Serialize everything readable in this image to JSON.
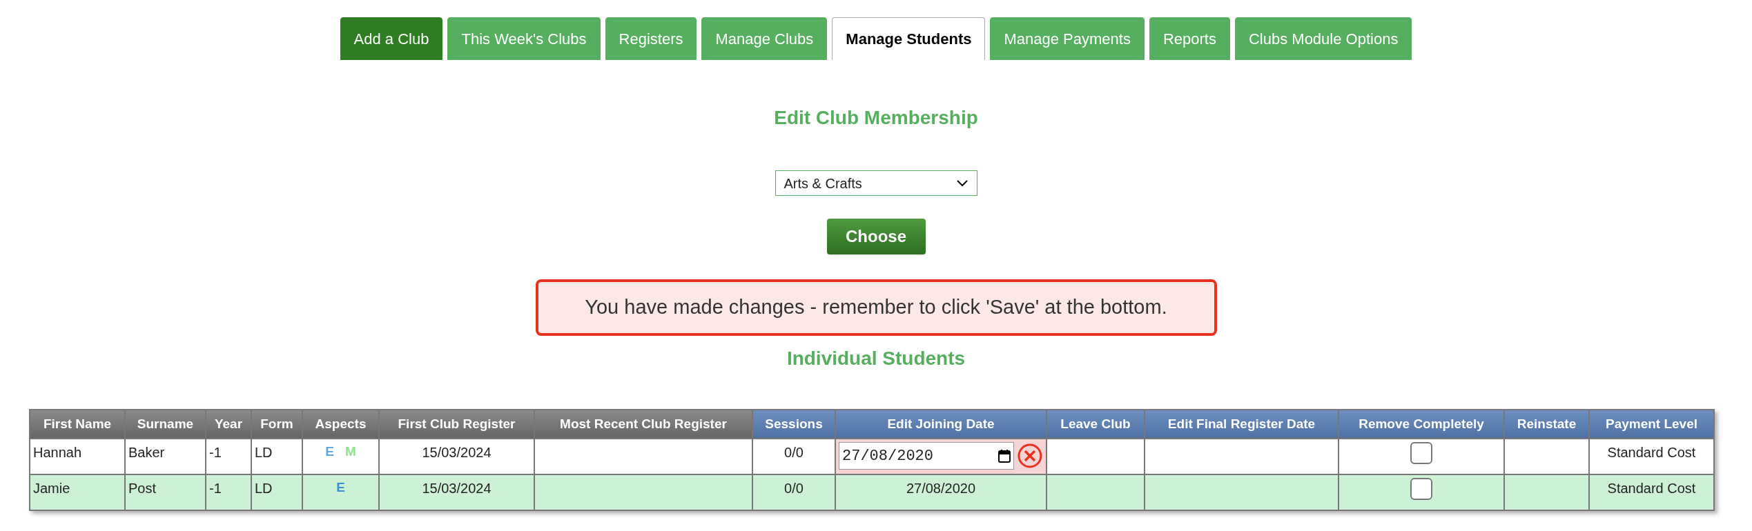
{
  "tabs": [
    {
      "label": "Add a Club",
      "selected": false,
      "kind": "primary"
    },
    {
      "label": "This Week's Clubs",
      "selected": false,
      "kind": "normal"
    },
    {
      "label": "Registers",
      "selected": false,
      "kind": "normal"
    },
    {
      "label": "Manage Clubs",
      "selected": false,
      "kind": "normal"
    },
    {
      "label": "Manage Students",
      "selected": true,
      "kind": "normal"
    },
    {
      "label": "Manage Payments",
      "selected": false,
      "kind": "normal"
    },
    {
      "label": "Reports",
      "selected": false,
      "kind": "normal"
    },
    {
      "label": "Clubs Module Options",
      "selected": false,
      "kind": "normal"
    }
  ],
  "heading": "Edit Club Membership",
  "club_select": {
    "value": "Arts & Crafts"
  },
  "choose_button": "Choose",
  "alert": "You have made changes - remember to click 'Save' at the bottom.",
  "subheading": "Individual Students",
  "table": {
    "columns": [
      {
        "label": "First Name",
        "kind": "info"
      },
      {
        "label": "Surname",
        "kind": "info"
      },
      {
        "label": "Year",
        "kind": "info"
      },
      {
        "label": "Form",
        "kind": "info"
      },
      {
        "label": "Aspects",
        "kind": "info"
      },
      {
        "label": "First Club Register",
        "kind": "info"
      },
      {
        "label": "Most Recent Club Register",
        "kind": "info"
      },
      {
        "label": "Sessions",
        "kind": "edit"
      },
      {
        "label": "Edit Joining Date",
        "kind": "edit"
      },
      {
        "label": "Leave Club",
        "kind": "edit"
      },
      {
        "label": "Edit Final Register Date",
        "kind": "edit"
      },
      {
        "label": "Remove Completely",
        "kind": "edit"
      },
      {
        "label": "Reinstate",
        "kind": "edit"
      },
      {
        "label": "Payment Level",
        "kind": "edit"
      }
    ],
    "rows": [
      {
        "editing": true,
        "first_name": "Hannah",
        "surname": "Baker",
        "year": "-1",
        "form": "LD",
        "aspects": [
          {
            "letter": "E",
            "color": "#5fa8e6"
          },
          {
            "letter": "M",
            "color": "#93e193"
          }
        ],
        "first_register": "15/03/2024",
        "sessions": "0/0",
        "joining_date": "27/08/2020",
        "remove_completely": false,
        "payment_level": "Standard Cost"
      },
      {
        "editing": false,
        "first_name": "Jamie",
        "surname": "Post",
        "year": "-1",
        "form": "LD",
        "aspects": [
          {
            "letter": "E",
            "color": "#3f8fd6"
          }
        ],
        "first_register": "15/03/2024",
        "sessions": "0/0",
        "joining_date": "27/08/2020",
        "remove_completely": false,
        "payment_level": "Standard Cost"
      }
    ]
  }
}
